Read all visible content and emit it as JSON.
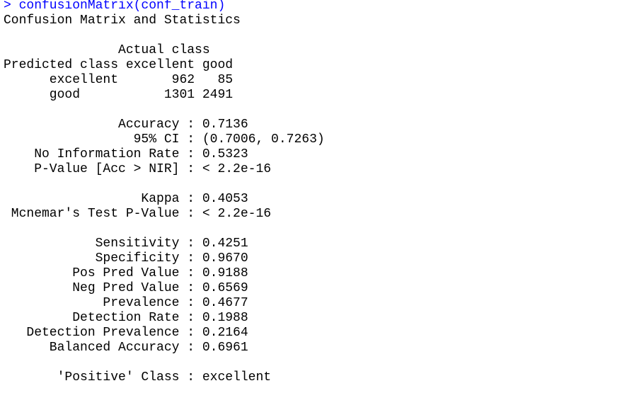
{
  "colors": {
    "command": "#0000ff",
    "output": "#000000",
    "background": "#ffffff"
  },
  "console": {
    "command": "> confusionMatrix(conf_train)",
    "output_lines": [
      "Confusion Matrix and Statistics",
      "",
      "               Actual class",
      "Predicted class excellent good",
      "      excellent       962   85",
      "      good           1301 2491",
      "",
      "               Accuracy : 0.7136",
      "                 95% CI : (0.7006, 0.7263)",
      "    No Information Rate : 0.5323",
      "    P-Value [Acc > NIR] : < 2.2e-16",
      "",
      "                  Kappa : 0.4053",
      " Mcnemar's Test P-Value : < 2.2e-16",
      "",
      "            Sensitivity : 0.4251",
      "            Specificity : 0.9670",
      "         Pos Pred Value : 0.9188",
      "         Neg Pred Value : 0.6569",
      "             Prevalence : 0.4677",
      "         Detection Rate : 0.1988",
      "   Detection Prevalence : 0.2164",
      "      Balanced Accuracy : 0.6961",
      "",
      "       'Positive' Class : excellent"
    ]
  }
}
